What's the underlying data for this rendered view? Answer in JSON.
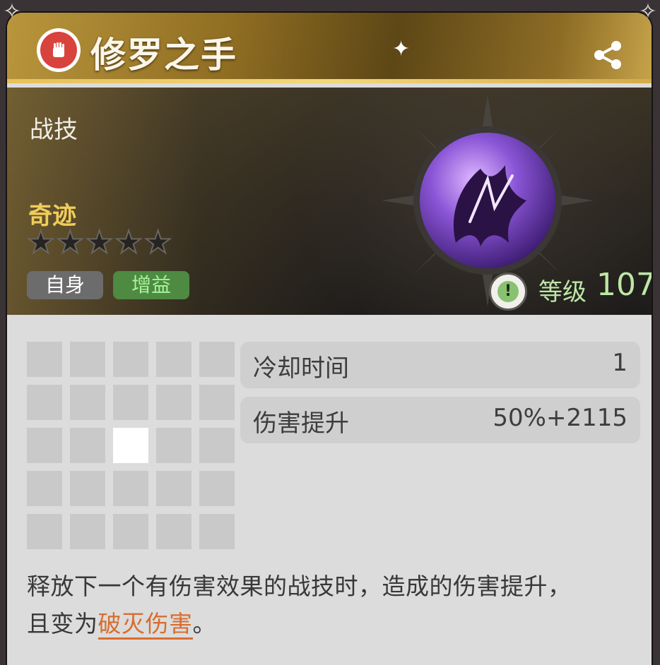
{
  "header": {
    "title": "修罗之手",
    "title_icon": "fist-icon",
    "share_icon": "share-icon"
  },
  "hero": {
    "type_label": "战技",
    "rarity_label": "奇迹",
    "stars": {
      "filled": 0,
      "total": 5
    },
    "tags": {
      "self": "自身",
      "buff": "增益"
    },
    "level": {
      "icon": "exclamation-icon",
      "label": "等级",
      "value": "107"
    },
    "emblem": "purple-orb-claw-icon"
  },
  "grid": {
    "rows": 5,
    "cols": 5,
    "active_cell": {
      "row": 3,
      "col": 3
    }
  },
  "stats": [
    {
      "name": "冷却时间",
      "value": "1"
    },
    {
      "name": "伤害提升",
      "value": "50%+2115"
    }
  ],
  "description": {
    "line1": "释放下一个有伤害效果的战技时，造成的伤害提升，",
    "line2_prefix": "且变为",
    "highlight": "破灭伤害",
    "suffix": "。"
  },
  "colors": {
    "accent_gold": "#f0cd5a",
    "level_green": "#bde7a5",
    "highlight_orange": "#d86d2f"
  }
}
